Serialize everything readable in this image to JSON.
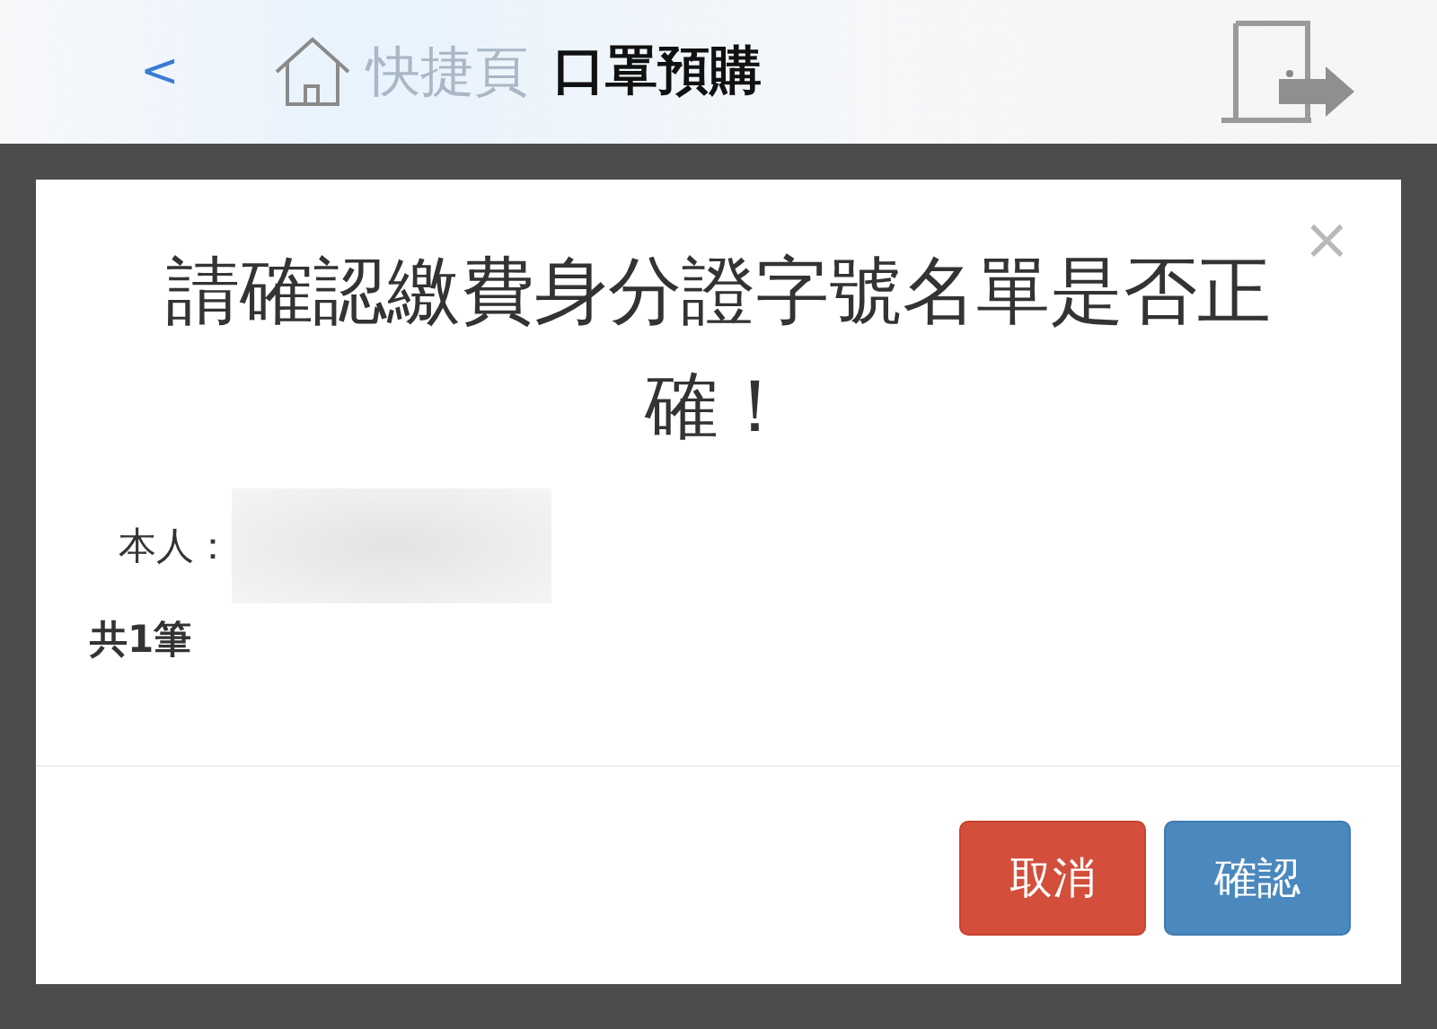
{
  "header": {
    "back": "<",
    "shortcut": "快捷頁",
    "title": "口罩預購"
  },
  "dialog": {
    "title": "請確認繳費身分證字號名單是否正確！",
    "close": "×",
    "rows": [
      {
        "label": "本人："
      }
    ],
    "count": "共1筆",
    "buttons": [
      {
        "label": "取消",
        "kind": "cancel"
      },
      {
        "label": "確認",
        "kind": "confirm"
      }
    ]
  }
}
